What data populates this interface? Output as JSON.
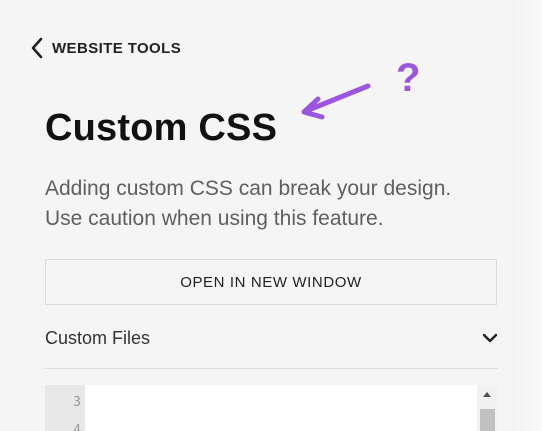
{
  "header": {
    "back_label": "WEBSITE TOOLS"
  },
  "page": {
    "title": "Custom CSS",
    "warning_line1": "Adding custom CSS can break your design.",
    "warning_line2": "Use caution when using this feature."
  },
  "annotation": {
    "question_mark": "?",
    "color": "#9b55e0"
  },
  "buttons": {
    "open_new_window": "OPEN IN NEW WINDOW"
  },
  "custom_files": {
    "label": "Custom Files",
    "icon": "chevron-down-icon"
  },
  "editor": {
    "line_numbers": [
      "3",
      "4"
    ]
  }
}
